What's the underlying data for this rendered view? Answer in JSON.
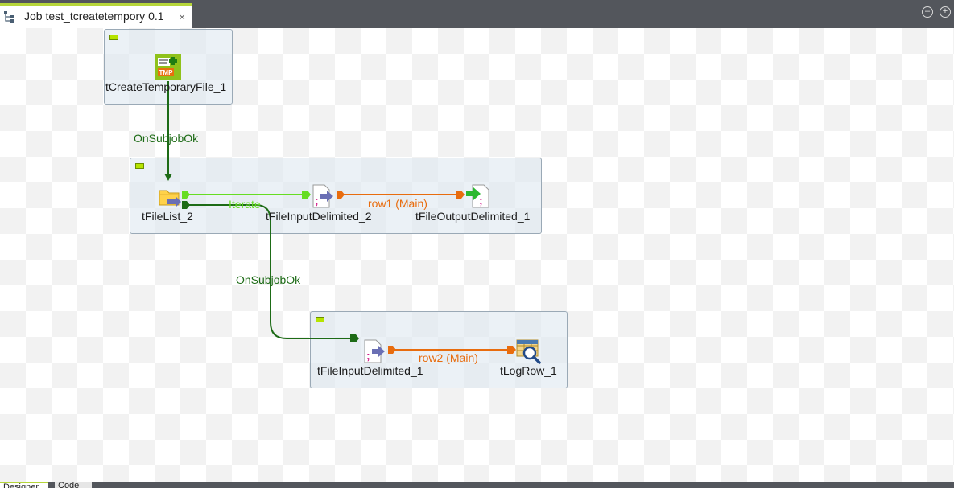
{
  "editor": {
    "tab_title": "Job test_tcreatetempory 0.1",
    "close_glyph": "×",
    "minimize_glyph": "–",
    "maximize_glyph": "+"
  },
  "components": {
    "tcreatetemporaryfile_1": {
      "label": "tCreateTemporaryFile_1",
      "icon": "temp-file-icon",
      "icon_text": "TMP"
    },
    "tfilelist_2": {
      "label": "tFileList_2",
      "icon": "folder-list-icon"
    },
    "tfileinputdelimited_2": {
      "label": "tFileInputDelimited_2",
      "icon": "file-input-icon"
    },
    "tfileoutputdelimited_1": {
      "label": "tFileOutputDelimited_1",
      "icon": "file-output-icon"
    },
    "tfileinputdelimited_1": {
      "label": "tFileInputDelimited_1",
      "icon": "file-input-icon"
    },
    "tlogrow_1": {
      "label": "tLogRow_1",
      "icon": "log-row-icon"
    }
  },
  "connections": {
    "onsubjobok_1": "OnSubjobOk",
    "iterate": "Iterate",
    "row1": "row1 (Main)",
    "onsubjobok_2": "OnSubjobOk",
    "row2": "row2 (Main)"
  },
  "colors": {
    "onsubjobok": "#1d6b16",
    "iterate": "#66dd22",
    "main": "#e86c0e",
    "tab_accent": "#b6d63a",
    "toolbar": "#53565c"
  },
  "bottom_tabs": [
    "Designer",
    "Code"
  ]
}
